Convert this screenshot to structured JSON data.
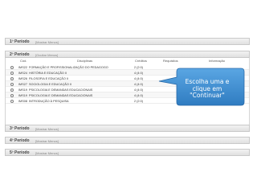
{
  "periods": [
    {
      "title": "1º Período",
      "toggle": "[Mostrar Menos]"
    },
    {
      "title": "2º Período",
      "toggle": "[Ocultar Menos]"
    },
    {
      "title": "3º Período",
      "toggle": "[Mostrar Menos]"
    },
    {
      "title": "4º Período",
      "toggle": "[Mostrar Menos]"
    },
    {
      "title": "5º Período",
      "toggle": "[Mostrar Menos]"
    }
  ],
  "table": {
    "headers": {
      "code": "Cód.",
      "discipline": "Disciplinas",
      "credits": "Créditos",
      "prereq": "Requisitos",
      "info": "Informação"
    },
    "rows": [
      {
        "code": "IMS22",
        "name": "FORMAÇÃO E PROFISSIONALIZAÇÃO DO PEDAGOGO",
        "credits": "2 (2:0)"
      },
      {
        "code": "IMS24",
        "name": "HISTÓRIA E EDUCAÇÃO II",
        "credits": "4 (4:0)"
      },
      {
        "code": "IMS26",
        "name": "FILOSOFIA E EDUCAÇÃO II",
        "credits": "4 (4:0)"
      },
      {
        "code": "IMS27",
        "name": "SOCIOLOGIA E EDUCAÇÃO II",
        "credits": "4 (4:0)"
      },
      {
        "code": "IMS19",
        "name": "PSICOLOGIA E DEMANDAS EDUCACIONAIS",
        "credits": "4 (4:0)"
      },
      {
        "code": "IMS19",
        "name": "PSICOLOGIA E DEMANDAS EDUCACIONAIS",
        "credits": "4 (4:0)"
      },
      {
        "code": "IMS08",
        "name": "INTRODUÇÃO À PESQUISA",
        "credits": "2 (2:0)"
      }
    ]
  },
  "callout": {
    "line1": "Escolha uma e",
    "line2": "clique em",
    "line3": "\"Continuar\"",
    "color": "#3f8fd2"
  }
}
